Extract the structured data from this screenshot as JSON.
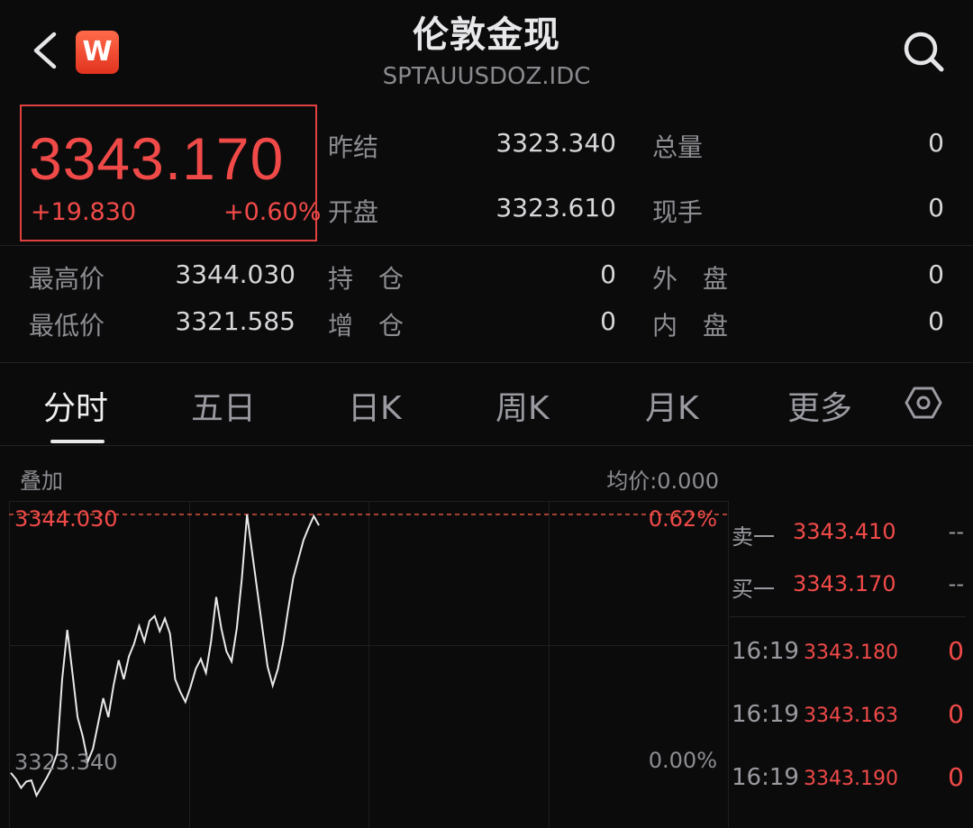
{
  "header": {
    "back_icon": "chevron-left-icon",
    "logo_letter": "W",
    "title": "伦敦金现",
    "subtitle": "SPTAUUSDOZ.IDC",
    "search_icon": "search-icon"
  },
  "quote": {
    "price": "3343.170",
    "change": "+19.830",
    "change_pct": "+0.60%",
    "stats": [
      {
        "label": "昨结",
        "value": "3323.340"
      },
      {
        "label": "总量",
        "value": "0"
      },
      {
        "label": "开盘",
        "value": "3323.610"
      },
      {
        "label": "现手",
        "value": "0"
      },
      {
        "label": "最高价",
        "value": "3344.030"
      },
      {
        "label": "持　仓",
        "value": "0"
      },
      {
        "label": "外　盘",
        "value": "0"
      },
      {
        "label": "最低价",
        "value": "3321.585"
      },
      {
        "label": "增　仓",
        "value": "0"
      },
      {
        "label": "内　盘",
        "value": "0"
      }
    ]
  },
  "tabs": [
    "分时",
    "五日",
    "日K",
    "周K",
    "月K",
    "更多"
  ],
  "settings_icon": "hexagon-settings-icon",
  "chart": {
    "overlay_label": "叠加",
    "avg_price_label": "均价:0.000",
    "top_price_label": "3344.030",
    "top_pct_label": "0.62%",
    "base_price_label": "3323.340",
    "base_pct_label": "0.00%"
  },
  "order_book": [
    {
      "label": "卖一",
      "price": "3343.410",
      "qty": "--"
    },
    {
      "label": "买一",
      "price": "3343.170",
      "qty": "--"
    }
  ],
  "ticks": [
    {
      "time": "16:19",
      "price": "3343.180",
      "qty": "0"
    },
    {
      "time": "16:19",
      "price": "3343.163",
      "qty": "0"
    },
    {
      "time": "16:19",
      "price": "3343.190",
      "qty": "0"
    }
  ],
  "chart_data": {
    "type": "line",
    "series": [
      {
        "values": [
          3323.6,
          3323.1,
          3322.4,
          3322.9,
          3323.0,
          3321.8,
          3322.5,
          3323.2,
          3324.0,
          3325.1,
          3331.0,
          3334.9,
          3331.5,
          3328.0,
          3326.5,
          3324.5,
          3325.5,
          3327.5,
          3329.5,
          3328.0,
          3330.5,
          3332.5,
          3331.0,
          3332.8,
          3333.8,
          3335.2,
          3334.0,
          3335.6,
          3336.0,
          3334.8,
          3335.8,
          3334.6,
          3331.0,
          3330.0,
          3329.2,
          3330.4,
          3331.8,
          3332.6,
          3331.5,
          3334.0,
          3337.5,
          3335.0,
          3333.2,
          3332.4,
          3335.0,
          3339.0,
          3344.03,
          3341.0,
          3338.0,
          3335.0,
          3332.0,
          3330.5,
          3331.8,
          3333.8,
          3336.5,
          3339.0,
          3340.5,
          3342.0,
          3343.0,
          3343.9,
          3343.17
        ]
      }
    ],
    "ylim": [
      3320.8,
      3344.6
    ],
    "reference_line": 3344.03
  }
}
